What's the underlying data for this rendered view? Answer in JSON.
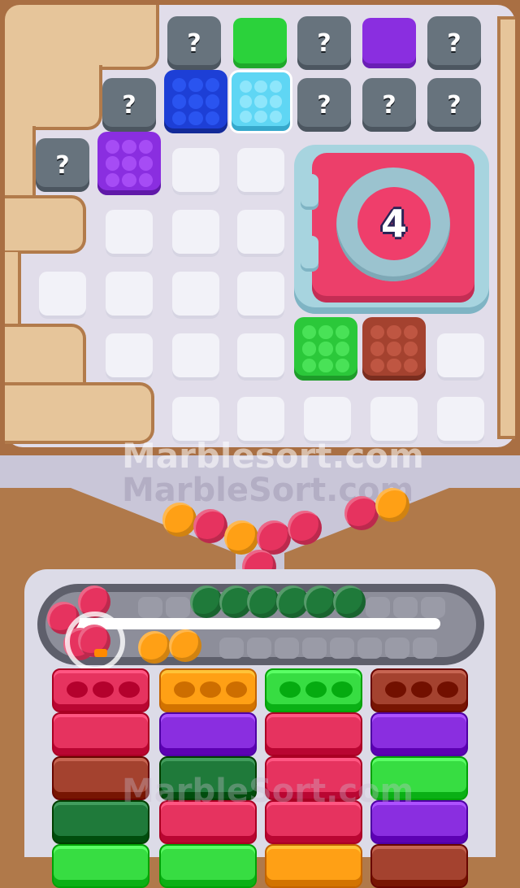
{
  "watermarks": [
    "Marblesort.com",
    "MarbleSort.com",
    "MarbleSort.com"
  ],
  "unknown_tiles": [
    "?",
    "?",
    "?",
    "?",
    "?",
    "?",
    "?",
    "?"
  ],
  "lock": {
    "count": "4",
    "color": "#ec3f6a"
  },
  "colors": {
    "blue": "#1d3fd6",
    "cyan": "#5fd6f4",
    "purple": "#8a2ee0",
    "green": "#2bd23b",
    "brown": "#a4422f",
    "pink": "#e6335f",
    "orange": "#ffa015",
    "dark_green": "#1f7a3a",
    "lime": "#37dd42"
  },
  "columns": [
    {
      "top": "pink",
      "segments": [
        "pink",
        "pink",
        "brown",
        "dark_green",
        "lime"
      ]
    },
    {
      "top": "orange",
      "segments": [
        "orange",
        "purple",
        "dark_green",
        "pink",
        "lime"
      ]
    },
    {
      "top": "lime",
      "segments": [
        "lime",
        "pink",
        "pink",
        "pink",
        "orange"
      ]
    },
    {
      "top": "brown",
      "segments": [
        "brown",
        "purple",
        "lime",
        "purple",
        "brown"
      ]
    }
  ]
}
